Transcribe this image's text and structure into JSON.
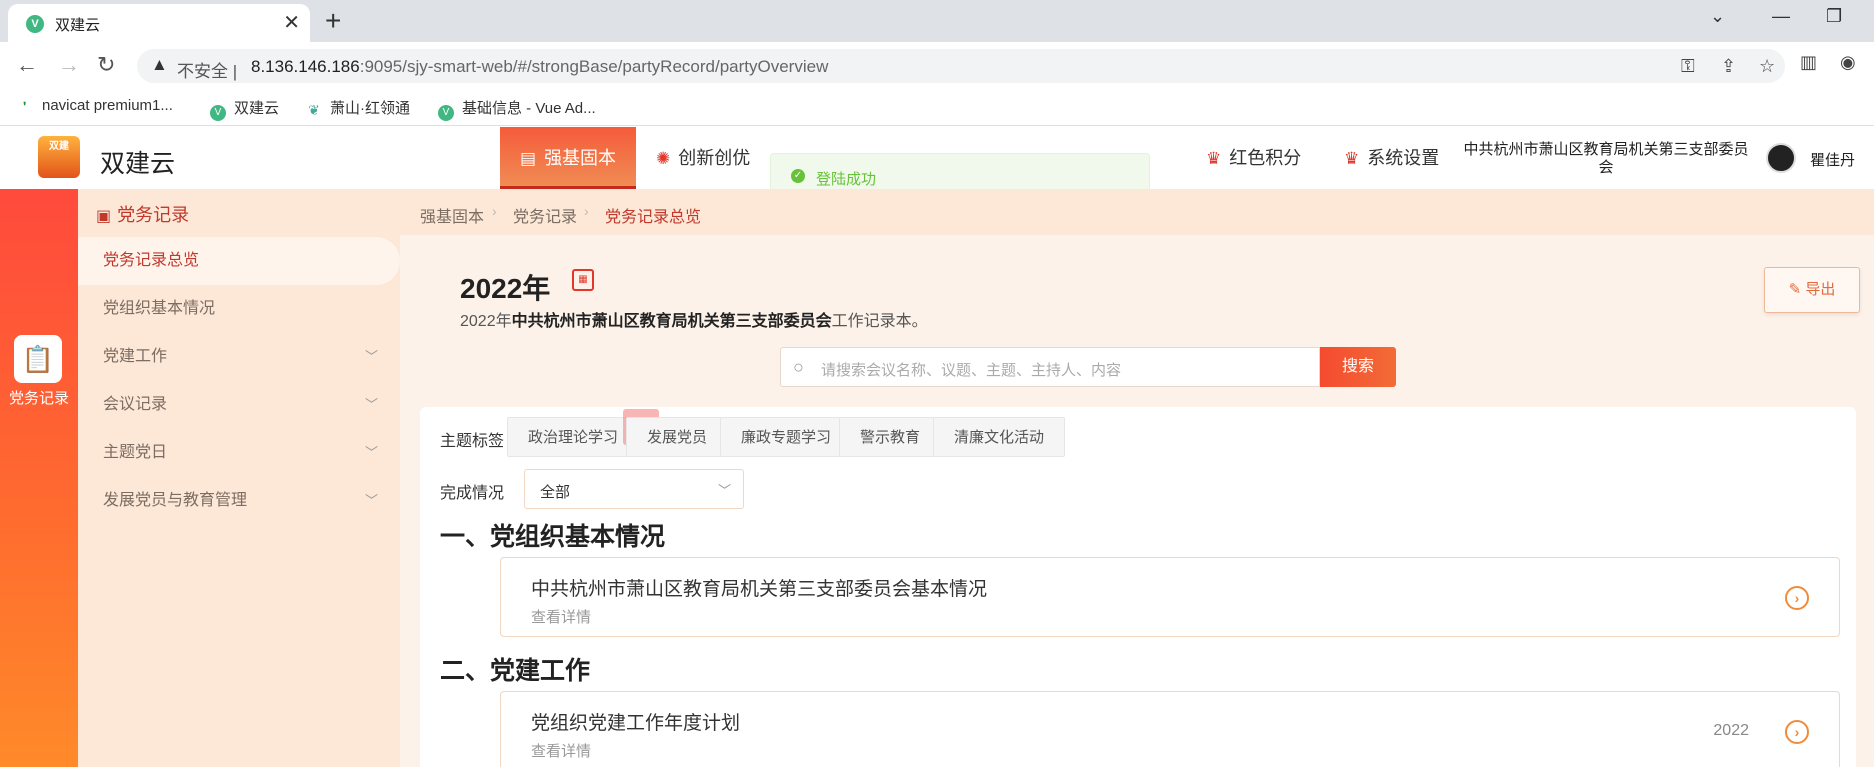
{
  "browser": {
    "tab_title": "双建云",
    "tab_favicon": "V",
    "insecure_label": "不安全",
    "url_host": "8.136.146.186",
    "url_rest": ":9095/sjy-smart-web/#/strongBase/partyRecord/partyOverview",
    "bookmarks": [
      {
        "label": "navicat premium1...",
        "icon": "navicat-icon"
      },
      {
        "label": "双建云",
        "icon": "vue-icon"
      },
      {
        "label": "萧山·红领通",
        "icon": "leaf-icon"
      },
      {
        "label": "基础信息 - Vue Ad...",
        "icon": "vue-icon"
      }
    ]
  },
  "app": {
    "name": "双建云",
    "logo_text": "双建",
    "nav": [
      {
        "label": "强基固本",
        "icon": "notebook-icon"
      },
      {
        "label": "创新创优",
        "icon": "bulb-icon"
      },
      {
        "label": "红色积分",
        "icon": "medal-icon"
      },
      {
        "label": "系统设置",
        "icon": "medal-icon"
      }
    ],
    "org": "中共杭州市萧山区教育局机关第三支部委员会",
    "user": "瞿佳丹"
  },
  "toast": {
    "message": "登陆成功"
  },
  "rail": {
    "label": "党务记录"
  },
  "sidebar": {
    "header": "党务记录",
    "items": [
      {
        "label": "党务记录总览"
      },
      {
        "label": "党组织基本情况"
      },
      {
        "label": "党建工作"
      },
      {
        "label": "会议记录"
      },
      {
        "label": "主题党日"
      },
      {
        "label": "发展党员与教育管理"
      }
    ]
  },
  "breadcrumb": [
    "强基固本",
    "党务记录",
    "党务记录总览"
  ],
  "main": {
    "year": "2022年",
    "subtitle_prefix": "2022年",
    "subtitle_org": "中共杭州市萧山区教育局机关第三支部委员会",
    "subtitle_suffix": "工作记录本。",
    "export_label": "导出",
    "search_placeholder": "请搜索会议名称、议题、主题、主持人、内容",
    "search_button": "搜索",
    "topic_label": "主题标签",
    "tags": [
      "政治理论学习",
      "发展党员",
      "廉政专题学习",
      "警示教育",
      "清廉文化活动"
    ],
    "status_label": "完成情况",
    "status_value": "全部",
    "sections": [
      {
        "title": "一、党组织基本情况",
        "card_title": "中共杭州市萧山区教育局机关第三支部委员会基本情况",
        "detail": "查看详情",
        "year": ""
      },
      {
        "title": "二、党建工作",
        "card_title": "党组织党建工作年度计划",
        "detail": "查看详情",
        "year": "2022"
      }
    ]
  }
}
